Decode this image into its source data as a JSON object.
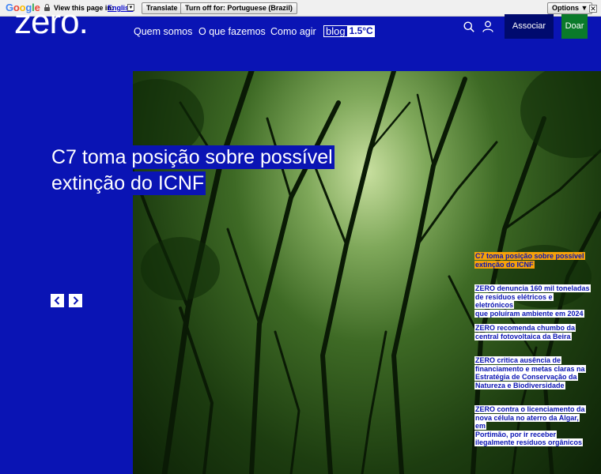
{
  "translate_bar": {
    "logo": [
      "G",
      "o",
      "o",
      "g",
      "l",
      "e"
    ],
    "view_text": "View this page in:",
    "language": "English",
    "translate_button": "Translate",
    "turn_off_button": "Turn off for: Portuguese (Brazil)",
    "options_button": "Options ▼",
    "close_glyph": "✕"
  },
  "header": {
    "logo": "zero.",
    "nav": [
      "Quem somos",
      "O que fazemos",
      "Como agir"
    ],
    "blog_left": "blog",
    "blog_right": "1.5°C",
    "associar": "Associar",
    "doar": "Doar"
  },
  "hero": {
    "headline_line1": "C7 toma posição sobre possível",
    "headline_line2": "extinção do ICNF"
  },
  "news": [
    {
      "lines": [
        "C7 toma posição sobre possível",
        "extinção do ICNF"
      ],
      "active": true
    },
    {
      "lines": [
        "ZERO denuncia 160 mil toneladas",
        "de resíduos elétricos e eletrónicos",
        "que poluíram ambiente em 2024"
      ],
      "active": false
    },
    {
      "lines": [
        "ZERO recomenda chumbo da",
        "central fotovoltaica da Beira"
      ],
      "active": false
    },
    {
      "lines": [
        "ZERO critica ausência de",
        "financiamento e metas claras na",
        "Estratégia de Conservação da",
        "Natureza e Biodiversidade"
      ],
      "active": false
    },
    {
      "lines": [
        "ZERO contra o licenciamento da",
        "nova célula no aterro da Algar, em",
        "Portimão, por ir receber",
        "ilegalmente resíduos orgânicos"
      ],
      "active": false
    }
  ],
  "colors": {
    "brand_blue": "#0a14b4",
    "accent_orange": "#f5a20a",
    "donate_green": "#0a7a2a"
  },
  "icons": [
    "search-icon",
    "user-icon",
    "chevron-left-icon",
    "chevron-right-icon",
    "lock-icon"
  ]
}
